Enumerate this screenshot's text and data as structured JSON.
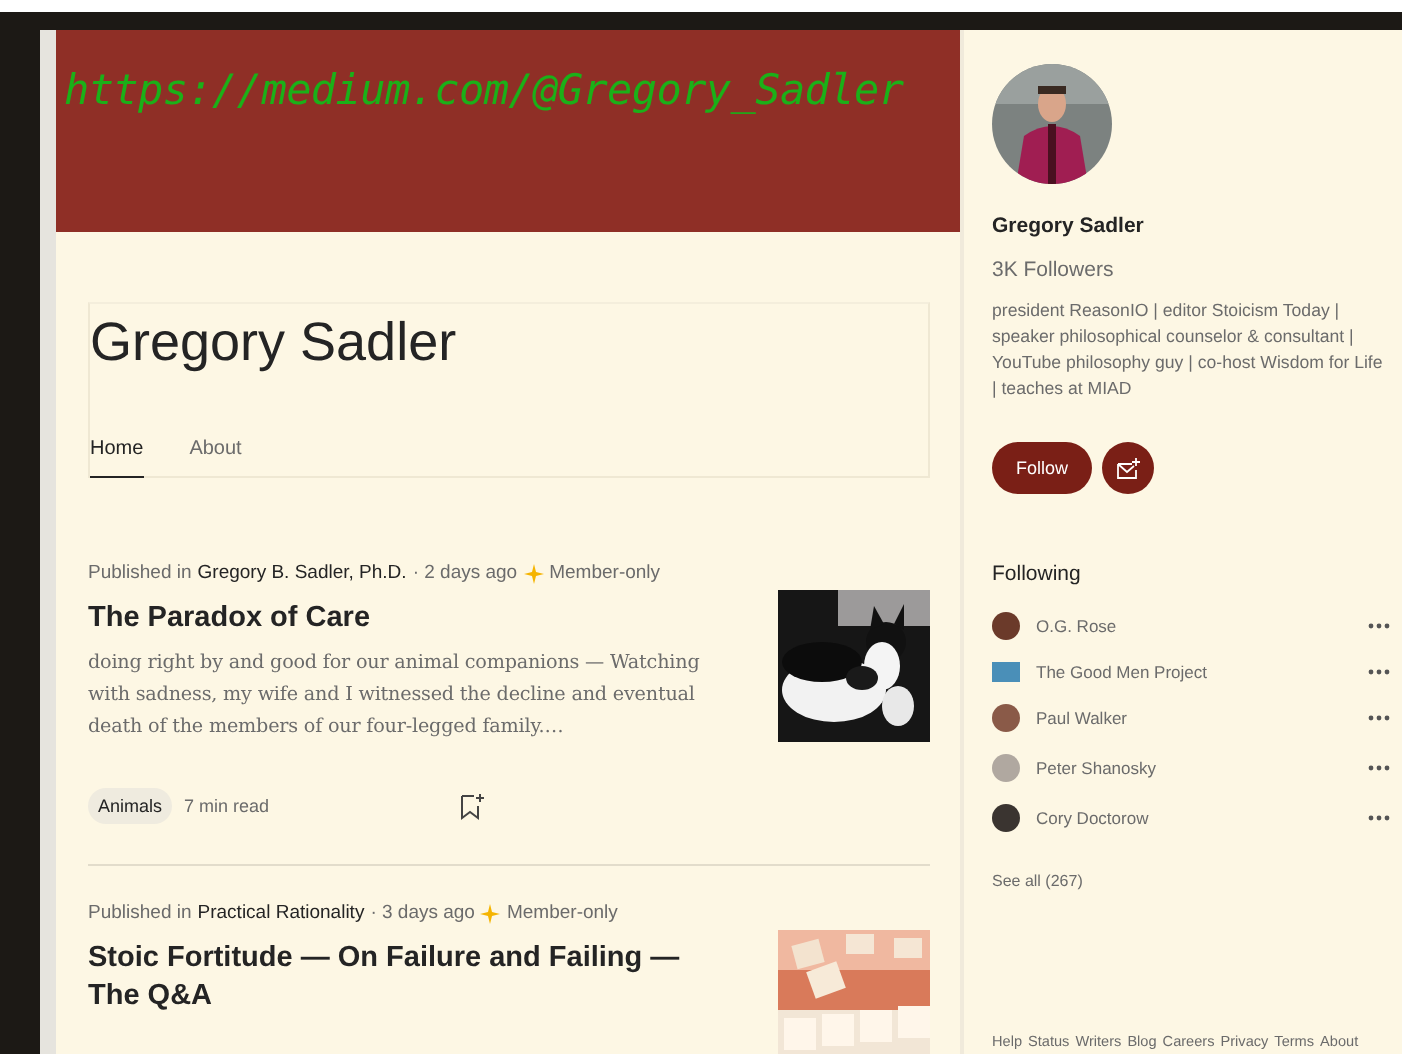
{
  "banner": {
    "caption": "https://medium.com/@Gregory_Sadler"
  },
  "profile_header": {
    "name": "Gregory Sadler",
    "tabs": [
      {
        "label": "Home",
        "selected": true
      },
      {
        "label": "About",
        "selected": false
      }
    ]
  },
  "articles": [
    {
      "published_prefix": "Published in",
      "publication": "Gregory B. Sadler, Ph.D.",
      "age": "· 2 days ago",
      "member_only": true,
      "member_label": "Member-only",
      "title": "The Paradox of Care",
      "excerpt": "doing right by and good for our animal companions — Watching with sadness, my wife and I witnessed the decline and eventual death of the members of our four-legged family.…",
      "tag": "Animals",
      "read_time": "7 min read",
      "thumbnail": {
        "kind": "cats"
      }
    },
    {
      "published_prefix": "Published in",
      "publication": "Practical Rationality",
      "age": "· 3 days ago",
      "member_only": true,
      "member_label": "Member-only",
      "title": "Stoic Fortitude — On Failure and Failing — The Q&A",
      "thumbnail": {
        "kind": "tiles"
      }
    }
  ],
  "sidebar": {
    "name": "Gregory Sadler",
    "followers": "3K Followers",
    "bio": "president ReasonIO | editor Stoicism Today | speaker philosophical counselor & consultant | YouTube philosophy guy | co-host Wisdom for Life | teaches at MIAD",
    "follow_button": "Follow",
    "following_title": "Following",
    "following": [
      {
        "name": "O.G. Rose",
        "kind": "round",
        "color": "#6b3a2a"
      },
      {
        "name": "The Good Men Project",
        "kind": "square",
        "color": "#4a8fb8"
      },
      {
        "name": "Paul Walker",
        "kind": "round",
        "color": "#8a5a48"
      },
      {
        "name": "Peter Shanosky",
        "kind": "round",
        "color": "#b0a8a0"
      },
      {
        "name": "Cory Doctorow",
        "kind": "round",
        "color": "#3a3430"
      }
    ],
    "see_all": "See all (267)",
    "footer_links": [
      "Help",
      "Status",
      "Writers",
      "Blog",
      "Careers",
      "Privacy",
      "Terms",
      "About"
    ]
  }
}
